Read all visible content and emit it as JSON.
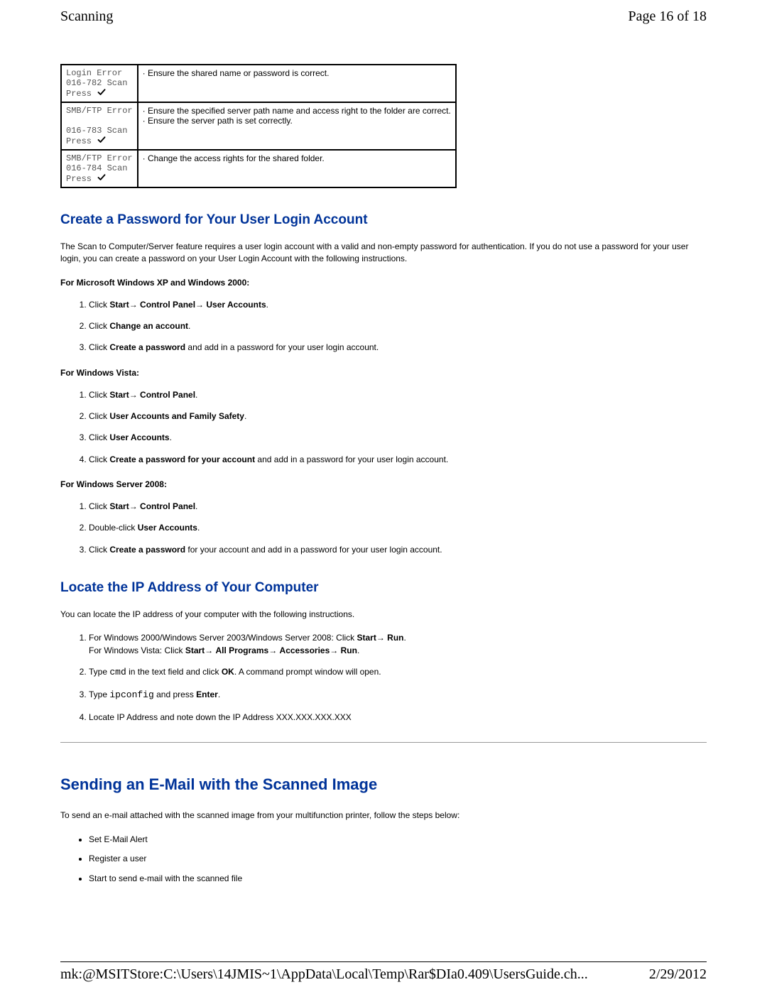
{
  "header": {
    "left": "Scanning",
    "right": "Page 16 of 18"
  },
  "error_table": {
    "rows": [
      {
        "code_line1": "Login Error",
        "code_line2": "016-782 Scan",
        "press": "Press",
        "desc": "· Ensure the shared name or password is correct."
      },
      {
        "code_line1": "SMB/FTP Error",
        "code_line2": "016-783 Scan",
        "press": "Press",
        "desc": "· Ensure the specified server path name and access right to the folder are correct.\n· Ensure the server path is set correctly."
      },
      {
        "code_line1": "SMB/FTP Error",
        "code_line2": "016-784 Scan",
        "press": "Press",
        "desc": "· Change the access rights for the shared folder."
      }
    ]
  },
  "sections": {
    "create_password": {
      "title": "Create a Password for Your User Login Account",
      "intro": "The Scan to Computer/Server feature requires a user login account with a valid and non-empty password for authentication. If you do not use a password for your user login, you can create a password on your User Login Account with the following instructions.",
      "groups": [
        {
          "heading": "For Microsoft Windows XP and Windows 2000:",
          "steps": [
            "Click <b>Start</b>→ <b>Control Panel</b>→ <b>User Accounts</b>.",
            "Click <b>Change an account</b>.",
            "Click <b>Create a password</b> and add in a password for your user login account."
          ]
        },
        {
          "heading": "For Windows Vista:",
          "steps": [
            "Click <b>Start</b>→ <b>Control Panel</b>.",
            "Click <b>User Accounts and Family Safety</b>.",
            "Click <b>User Accounts</b>.",
            "Click <b>Create a password for your account</b> and add in a password for your user login account."
          ]
        },
        {
          "heading": "For Windows Server 2008:",
          "steps": [
            "Click <b>Start</b>→ <b>Control Panel</b>.",
            "Double-click <b>User Accounts</b>.",
            "Click <b>Create a password</b> for your account and add in a password for your user login account."
          ]
        }
      ]
    },
    "locate_ip": {
      "title": "Locate the IP Address of Your Computer",
      "intro": "You can locate the IP address of your computer with the following instructions.",
      "steps": [
        "For Windows 2000/Windows Server 2003/Windows Server 2008: Click <b>Start</b>→ <b>Run</b>.\nFor Windows Vista: Click <b>Start</b>→ <b>All Programs</b>→ <b>Accessories</b>→ <b>Run</b>.",
        "Type <code>cmd</code> in the text field and click <b>OK</b>. A command prompt window will open.",
        "Type <code>ipconfig</code> and press <b>Enter</b>.",
        "Locate IP Address and note down the IP Address XXX.XXX.XXX.XXX"
      ]
    },
    "sending_email": {
      "title": "Sending an E-Mail with the Scanned Image",
      "intro": "To send an e-mail attached with the scanned image from your multifunction printer, follow the steps below:",
      "bullets": [
        "Set E-Mail Alert",
        "Register a user",
        "Start to send e-mail with the scanned file"
      ]
    }
  },
  "footer": {
    "left": "mk:@MSITStore:C:\\Users\\14JMIS~1\\AppData\\Local\\Temp\\Rar$DIa0.409\\UsersGuide.ch...",
    "right": "2/29/2012"
  }
}
